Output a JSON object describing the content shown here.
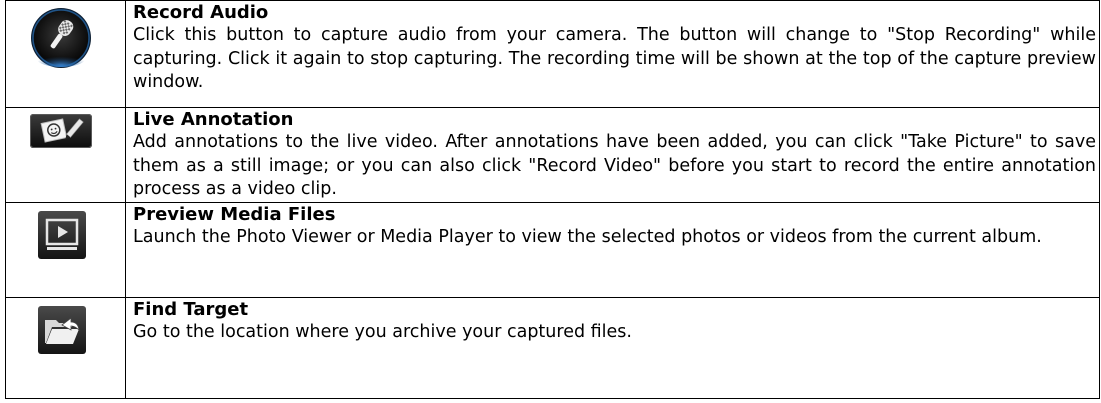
{
  "features": [
    {
      "icon": "microphone-icon",
      "title": "Record Audio",
      "description": "Click this button to capture audio from your camera. The button will change to \"Stop Recording\" while capturing. Click it again to stop capturing. The recording time will be shown at the top of the capture preview window."
    },
    {
      "icon": "annotation-icon",
      "title": "Live Annotation",
      "description": "Add annotations to the live video. After annotations have been added, you can click \"Take Picture\" to save them as a still image; or you can also click \"Record Video\" before you start to record the entire annotation process as a video clip."
    },
    {
      "icon": "play-preview-icon",
      "title": "Preview Media Files",
      "description": "Launch the Photo Viewer or Media Player to view the selected photos or videos from the current album."
    },
    {
      "icon": "folder-open-icon",
      "title": "Find Target",
      "description": "Go to the location where you archive your captured files."
    }
  ],
  "colors": {
    "icon_dark": "#1a1a1a",
    "icon_blue_glow": "#2a6fb5",
    "border": "#000000"
  }
}
